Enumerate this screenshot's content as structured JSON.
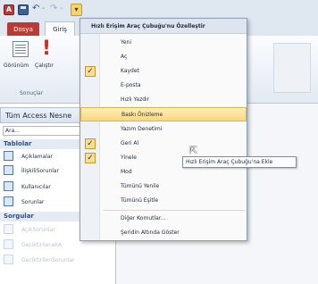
{
  "quick_access": {
    "logo_letter": "A",
    "undo_glyph": "↶",
    "dash": "-",
    "redo_glyph": "↷",
    "dash2": "-",
    "customize_glyph": "▾"
  },
  "ribbon": {
    "file_tab": "Dosya",
    "home_tab": "Giriş",
    "view_label": "Görünüm",
    "run_label": "Çalıştır",
    "results_group": "Sonuçlar",
    "run_icon_glyph": "!"
  },
  "nav": {
    "header": "Tüm Access Nesne",
    "search_value": "Ara...",
    "groups": [
      {
        "label": "Tablolar",
        "items": [
          "Açıklamalar",
          "İlişkiliSorunlar",
          "Kullanıcılar",
          "Sorunlar"
        ]
      },
      {
        "label": "Sorgular",
        "items": [
          "AçıkSorunlar",
          "GeciktirilecekA",
          "GeciktirilenSorunlar"
        ]
      }
    ]
  },
  "menu": {
    "title": "Hızlı Erişim Araç Çubuğu'nu Özelleştir",
    "items": [
      {
        "label": "Yeni",
        "checked": false
      },
      {
        "label": "Aç",
        "checked": false
      },
      {
        "label": "Kaydet",
        "checked": true
      },
      {
        "label": "E-posta",
        "checked": false
      },
      {
        "label": "Hızlı Yazdır",
        "checked": false
      },
      {
        "label": "Baskı Önizleme",
        "checked": false,
        "highlighted": true
      },
      {
        "label": "Yazım Denetimi",
        "checked": false
      },
      {
        "label": "Geri Al",
        "checked": true
      },
      {
        "label": "Yinele",
        "checked": true
      },
      {
        "label": "Mod",
        "checked": false
      },
      {
        "label": "Tümünü Yenile",
        "checked": false
      },
      {
        "label": "Tümünü Eşitle",
        "checked": false
      },
      {
        "label": "Diğer Komutlar...",
        "checked": false
      },
      {
        "label": "Şeridin Altında Göster",
        "checked": false
      }
    ],
    "check_glyph": "✓"
  },
  "tooltip": "Hızlı Erişim Araç Çubuğu'na Ekle",
  "cursor_glyph": "⇱"
}
